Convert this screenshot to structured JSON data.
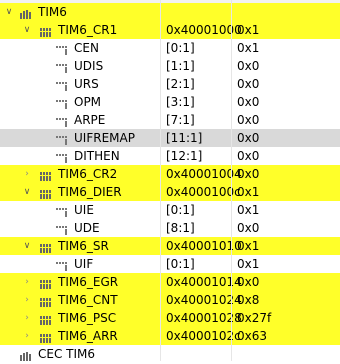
{
  "peripheral": {
    "name": "TIM6",
    "icon": "peripheral-icon",
    "expanded": true,
    "highlighted": true
  },
  "registers": [
    {
      "name": "TIM6_CR1",
      "address": "0x40001000",
      "value": "0x1",
      "expanded": true,
      "highlighted": true,
      "fields": [
        {
          "name": "CEN",
          "range": "[0:1]",
          "value": "0x1"
        },
        {
          "name": "UDIS",
          "range": "[1:1]",
          "value": "0x0"
        },
        {
          "name": "URS",
          "range": "[2:1]",
          "value": "0x0"
        },
        {
          "name": "OPM",
          "range": "[3:1]",
          "value": "0x0"
        },
        {
          "name": "ARPE",
          "range": "[7:1]",
          "value": "0x0"
        },
        {
          "name": "UIFREMAP",
          "range": "[11:1]",
          "value": "0x0",
          "selected": true
        },
        {
          "name": "DITHEN",
          "range": "[12:1]",
          "value": "0x0"
        }
      ]
    },
    {
      "name": "TIM6_CR2",
      "address": "0x40001004",
      "value": "0x0",
      "expanded": false,
      "highlighted": true,
      "fields": []
    },
    {
      "name": "TIM6_DIER",
      "address": "0x4000100c",
      "value": "0x1",
      "expanded": true,
      "highlighted": true,
      "fields": [
        {
          "name": "UIE",
          "range": "[0:1]",
          "value": "0x1"
        },
        {
          "name": "UDE",
          "range": "[8:1]",
          "value": "0x0"
        }
      ]
    },
    {
      "name": "TIM6_SR",
      "address": "0x40001010",
      "value": "0x1",
      "expanded": true,
      "highlighted": true,
      "fields": [
        {
          "name": "UIF",
          "range": "[0:1]",
          "value": "0x1"
        }
      ]
    },
    {
      "name": "TIM6_EGR",
      "address": "0x40001014",
      "value": "0x0",
      "expanded": false,
      "highlighted": true,
      "fields": []
    },
    {
      "name": "TIM6_CNT",
      "address": "0x40001024",
      "value": "0x8",
      "expanded": false,
      "highlighted": true,
      "fields": []
    },
    {
      "name": "TIM6_PSC",
      "address": "0x40001028",
      "value": "0x27f",
      "expanded": false,
      "highlighted": true,
      "fields": []
    },
    {
      "name": "TIM6_ARR",
      "address": "0x4000102c",
      "value": "0x63",
      "expanded": false,
      "highlighted": true,
      "fields": []
    }
  ],
  "next_peripheral": {
    "name": "CEC TIM6",
    "partially_visible": true
  },
  "colors": {
    "highlight": "#ffff29",
    "selected": "#d9d9d9",
    "icon": "#555555"
  },
  "icons": {
    "register": "register-icon",
    "field": "field-icon",
    "expand": "chevron-down-icon",
    "collapse": "chevron-right-icon"
  }
}
